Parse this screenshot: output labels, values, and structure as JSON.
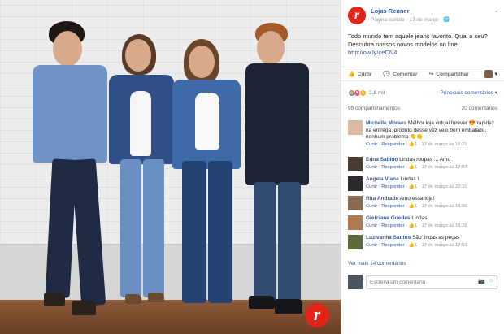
{
  "photo": {
    "brand_glyph": "r"
  },
  "post": {
    "page_name": "Lojas Renner",
    "meta": "Página curtida · 17 de março · ",
    "text": "Todo mundo tem aquele jeans favorito. Qual o seu? Descubra nossos novos modelos on line: ",
    "link": "http://ow.ly/ceCN4",
    "actions": {
      "like": "Curtir",
      "comment": "Comentar",
      "share": "Compartilhar"
    },
    "reaction_count": "3,8 mil",
    "relevant_label": "Principais comentários ▾",
    "shares": "99 compartilhamentos",
    "comments_count": "20 comentários",
    "more_comments": "Ver mais 14 comentários",
    "composer_placeholder": "Escreva um comentário"
  },
  "comments": [
    {
      "name": "Michelle Moraes",
      "text": "Melhor loja virtual forever 😍 rapidez na entrega, produto desse vez veio bem embalado, nenhum problema 👏👏",
      "meta_action_like": "Curtir",
      "meta_action_reply": "Responder",
      "likes": "1",
      "time": "17 de março às 16:21"
    },
    {
      "name": "Edna Sabino",
      "text": "Lindas roupas ... Amo",
      "meta_action_like": "Curtir",
      "meta_action_reply": "Responder",
      "likes": "1",
      "time": "17 de março às 17:07"
    },
    {
      "name": "Angela Viana",
      "text": "Lindas !",
      "meta_action_like": "Curtir",
      "meta_action_reply": "Responder",
      "likes": "1",
      "time": "17 de março às 22:31"
    },
    {
      "name": "Rita Andrade",
      "text": "Amo essa loja!",
      "meta_action_like": "Curtir",
      "meta_action_reply": "Responder",
      "likes": "1",
      "time": "17 de março às 16:50"
    },
    {
      "name": "Gleiciane Guedes",
      "text": "Lindas",
      "meta_action_like": "Curtir",
      "meta_action_reply": "Responder",
      "likes": "1",
      "time": "17 de março às 16:29"
    },
    {
      "name": "Luzivanha Santos",
      "text": "São lindas as peças",
      "meta_action_like": "Curtir",
      "meta_action_reply": "Responder",
      "likes": "1",
      "time": "17 de março às 17:53"
    }
  ],
  "colors": {
    "brand_red": "#e2231a",
    "link_blue": "#365899",
    "like_blue": "#5890ff",
    "love_red": "#f25268",
    "haha_yellow": "#f7b125"
  }
}
